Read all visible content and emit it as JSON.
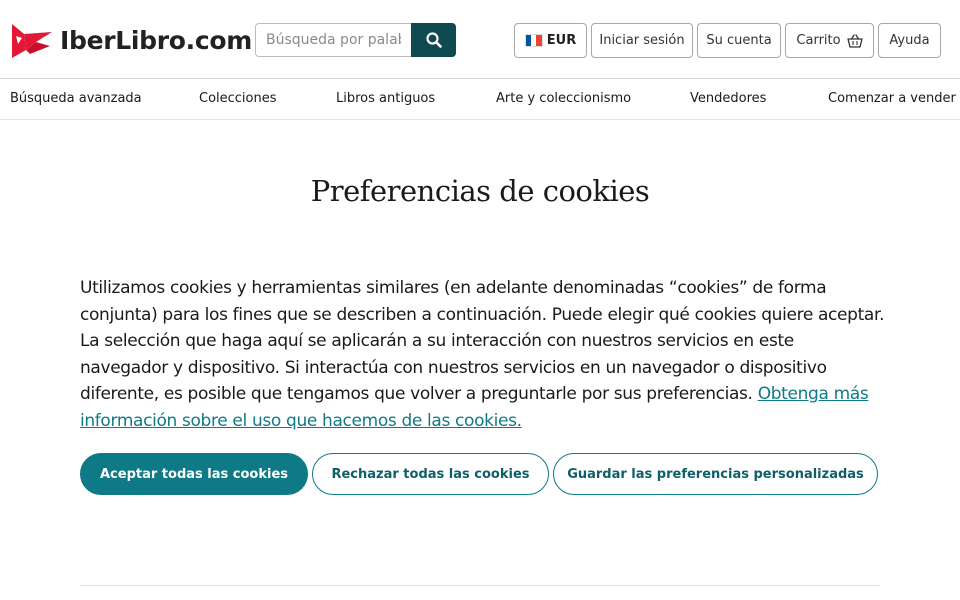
{
  "header": {
    "logo_text": "IberLibro.com",
    "search": {
      "placeholder": "Búsqueda por palabra clave",
      "value": ""
    },
    "currency_label": "EUR",
    "login_label": "Iniciar sesión",
    "account_label": "Su cuenta",
    "cart_label": "Carrito",
    "help_label": "Ayuda"
  },
  "nav": {
    "items": [
      {
        "label": "Búsqueda avanzada"
      },
      {
        "label": "Colecciones"
      },
      {
        "label": "Libros antiguos"
      },
      {
        "label": "Arte y coleccionismo"
      },
      {
        "label": "Vendedores"
      },
      {
        "label": "Comenzar a vender"
      }
    ]
  },
  "main": {
    "title": "Preferencias de cookies",
    "body": "Utilizamos cookies y herramientas similares (en adelante denominadas “cookies” de forma conjunta) para los fines que se describen a continuación. Puede elegir qué cookies quiere aceptar. La selección que haga aquí se aplicarán a su interacción con nuestros servicios en este navegador y dispositivo. Si interactúa con nuestros servicios en un navegador o dispositivo diferente, es posible que tengamos que volver a preguntarle por sus preferencias.",
    "link_text": "Obtenga más información sobre el uso que hacemos de las cookies.",
    "buttons": {
      "accept_all": "Aceptar todas las cookies",
      "reject_all": "Rechazar todas las cookies",
      "save_custom": "Guardar las preferencias personalizadas"
    }
  },
  "colors": {
    "brand_red": "#e31837",
    "search_button": "#0e4a50",
    "accent_teal": "#0e7a86",
    "flag_blue": "#0055a4",
    "flag_white": "#ffffff",
    "flag_red": "#ef4135"
  },
  "icons": {
    "logo": "bird-logo-icon",
    "search": "search-icon",
    "flag": "france-flag-icon",
    "cart": "basket-icon"
  }
}
